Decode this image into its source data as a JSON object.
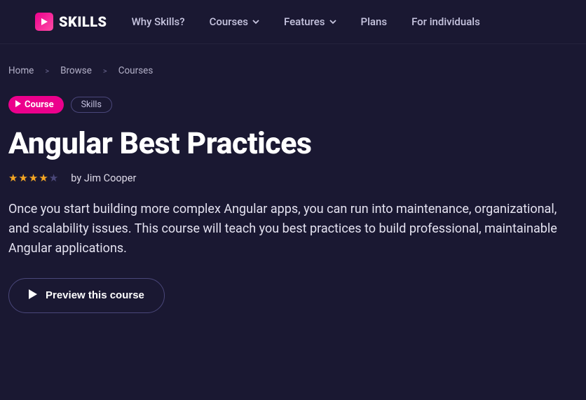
{
  "header": {
    "logo_text": "SKILLS",
    "nav": [
      {
        "label": "Why Skills?",
        "has_dropdown": false
      },
      {
        "label": "Courses",
        "has_dropdown": true
      },
      {
        "label": "Features",
        "has_dropdown": true
      },
      {
        "label": "Plans",
        "has_dropdown": false
      },
      {
        "label": "For individuals",
        "has_dropdown": false
      }
    ]
  },
  "breadcrumbs": {
    "items": [
      "Home",
      "Browse",
      "Courses"
    ]
  },
  "badges": {
    "course": "Course",
    "skills": "Skills"
  },
  "course": {
    "title": "Angular Best Practices",
    "rating": 4,
    "author_prefix": "by",
    "author": "Jim Cooper",
    "description": "Once you start building more complex Angular apps, you can run into maintenance, organizational, and scalability issues. This course will teach you best practices to build professional, maintainable Angular applications.",
    "preview_label": "Preview this course"
  }
}
